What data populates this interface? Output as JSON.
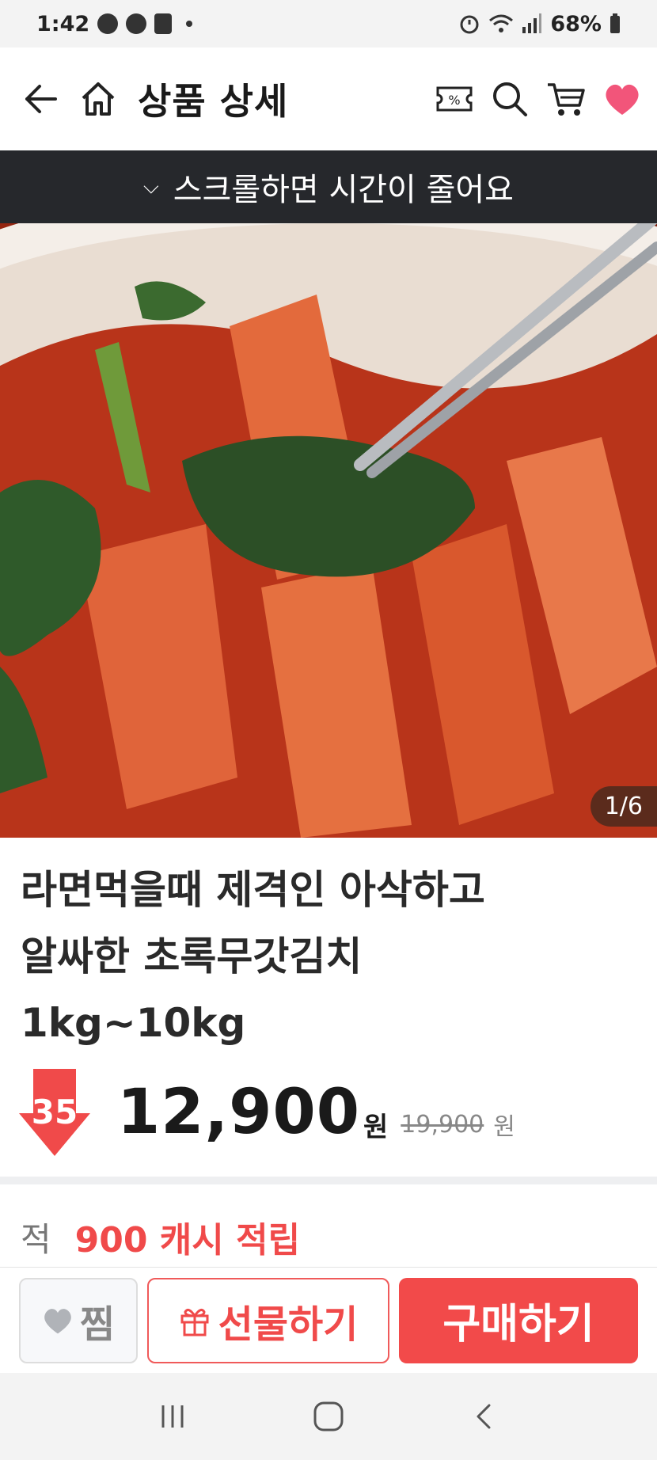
{
  "status_bar": {
    "time": "1:42",
    "battery": "68%"
  },
  "header": {
    "title": "상품 상세"
  },
  "banner": {
    "text": "스크롤하면 시간이 줄어요"
  },
  "gallery": {
    "counter": "1/6"
  },
  "product": {
    "title_line1": "라면먹을때 제격인 아삭하고",
    "title_line2": "알싸한 초록무갓김치",
    "title_line3": "1kg~10kg",
    "discount": "35",
    "price": "12,900",
    "price_unit": "원",
    "original_price": "19,900",
    "original_unit": "원"
  },
  "cash": {
    "label": "적",
    "value": "900 캐시 적립"
  },
  "actions": {
    "wish_label": "찜",
    "gift_label": "선물하기",
    "buy_label": "구매하기"
  },
  "colors": {
    "accent": "#f24a4a",
    "banner_bg": "#26282c",
    "heart": "#f2557a"
  }
}
